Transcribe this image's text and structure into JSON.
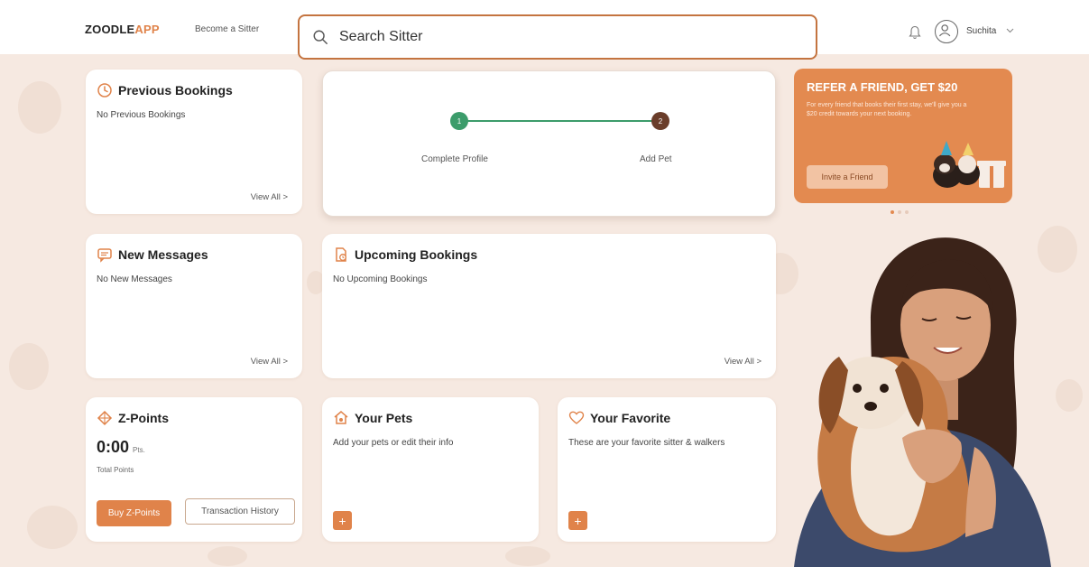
{
  "header": {
    "logo_main": "ZOODLE",
    "logo_accent": "APP",
    "become_sitter": "Become a Sitter",
    "search_text": "Search Sitter",
    "user_name": "Suchita"
  },
  "previous_bookings": {
    "title": "Previous Bookings",
    "empty_text": "No Previous Bookings",
    "view_all": "View All >"
  },
  "profile_stepper": {
    "steps": [
      {
        "number": "1",
        "label": "Complete Profile",
        "status": "active"
      },
      {
        "number": "2",
        "label": "Add Pet",
        "status": "pending"
      }
    ]
  },
  "promo": {
    "title": "REFER A FRIEND, GET $20",
    "text": "For every friend that books their first stay, we'll give you a $20 credit towards your next booking.",
    "button_label": "Invite a Friend",
    "carousel_dots": 3,
    "carousel_active": 1
  },
  "new_messages": {
    "title": "New Messages",
    "empty_text": "No New Messages",
    "view_all": "View All >"
  },
  "upcoming_bookings": {
    "title": "Upcoming Bookings",
    "empty_text": "No Upcoming Bookings",
    "view_all": "View All >"
  },
  "z_points": {
    "title": "Z-Points",
    "value": "0:00",
    "unit": "Pts.",
    "label": "Total Points",
    "buy_button": "Buy Z-Points",
    "history_button": "Transaction History"
  },
  "your_pets": {
    "title": "Your Pets",
    "description": "Add your pets or edit their info",
    "add_label": "+"
  },
  "your_favorite": {
    "title": "Your Favorite",
    "description": "These are your favorite sitter & walkers",
    "add_label": "+"
  },
  "colors": {
    "accent": "#e0834a",
    "step_active": "#3c9c6b",
    "step_pending": "#6a3d2a",
    "background": "#f6e9e1"
  }
}
